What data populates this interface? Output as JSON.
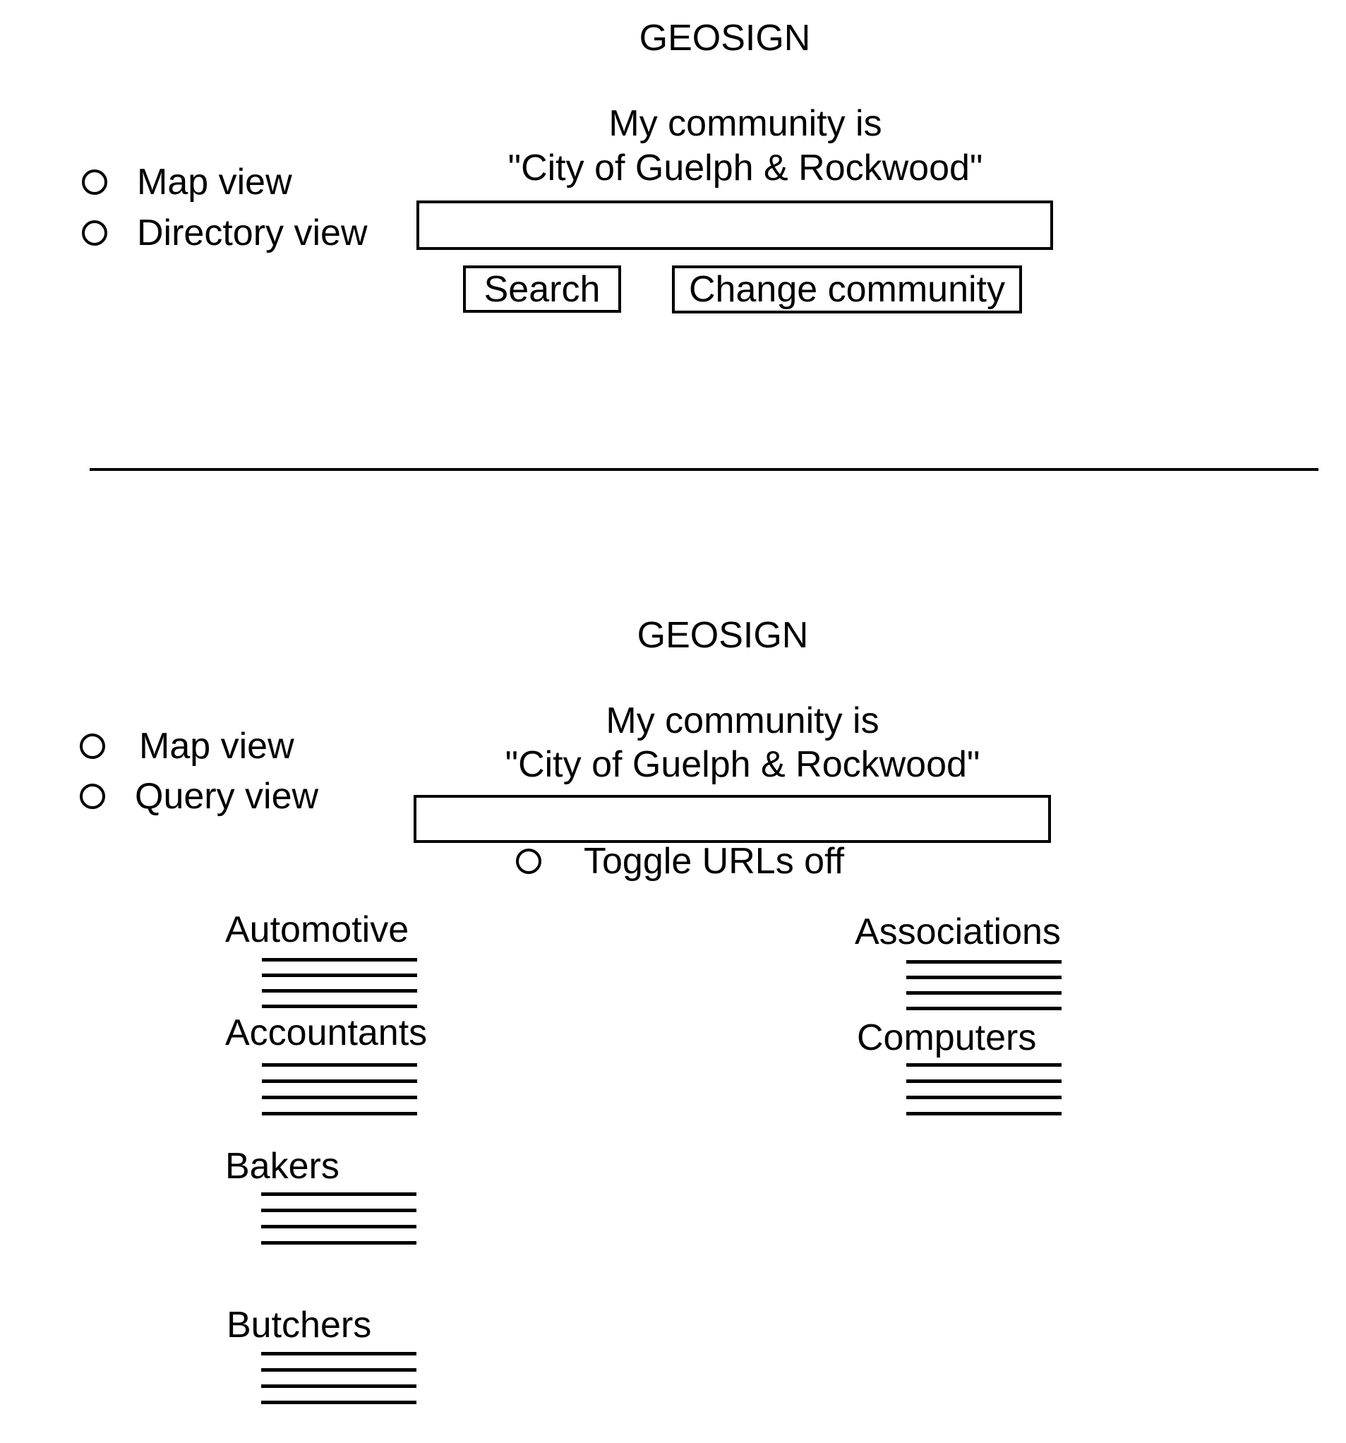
{
  "screen1": {
    "title": "GEOSIGN",
    "community_line1": "My community is",
    "community_line2": "\"City of Guelph & Rockwood\"",
    "view_options": [
      {
        "label": "Map view",
        "selected": false
      },
      {
        "label": "Directory view",
        "selected": false
      }
    ],
    "search_input": {
      "value": "",
      "placeholder": ""
    },
    "search_button": "Search",
    "change_community_button": "Change community"
  },
  "screen2": {
    "title": "GEOSIGN",
    "community_line1": "My community is",
    "community_line2": "\"City of Guelph & Rockwood\"",
    "view_options": [
      {
        "label": "Map view",
        "selected": false
      },
      {
        "label": "Query view",
        "selected": false
      }
    ],
    "search_input": {
      "value": "",
      "placeholder": ""
    },
    "toggle_urls_label": "Toggle URLs off",
    "categories_left": [
      {
        "name": "Automotive",
        "entries": 4
      },
      {
        "name": "Accountants",
        "entries": 4
      },
      {
        "name": "Bakers",
        "entries": 4
      },
      {
        "name": "Butchers",
        "entries": 4
      }
    ],
    "categories_right": [
      {
        "name": "Associations",
        "entries": 4
      },
      {
        "name": "Computers",
        "entries": 4
      }
    ]
  }
}
